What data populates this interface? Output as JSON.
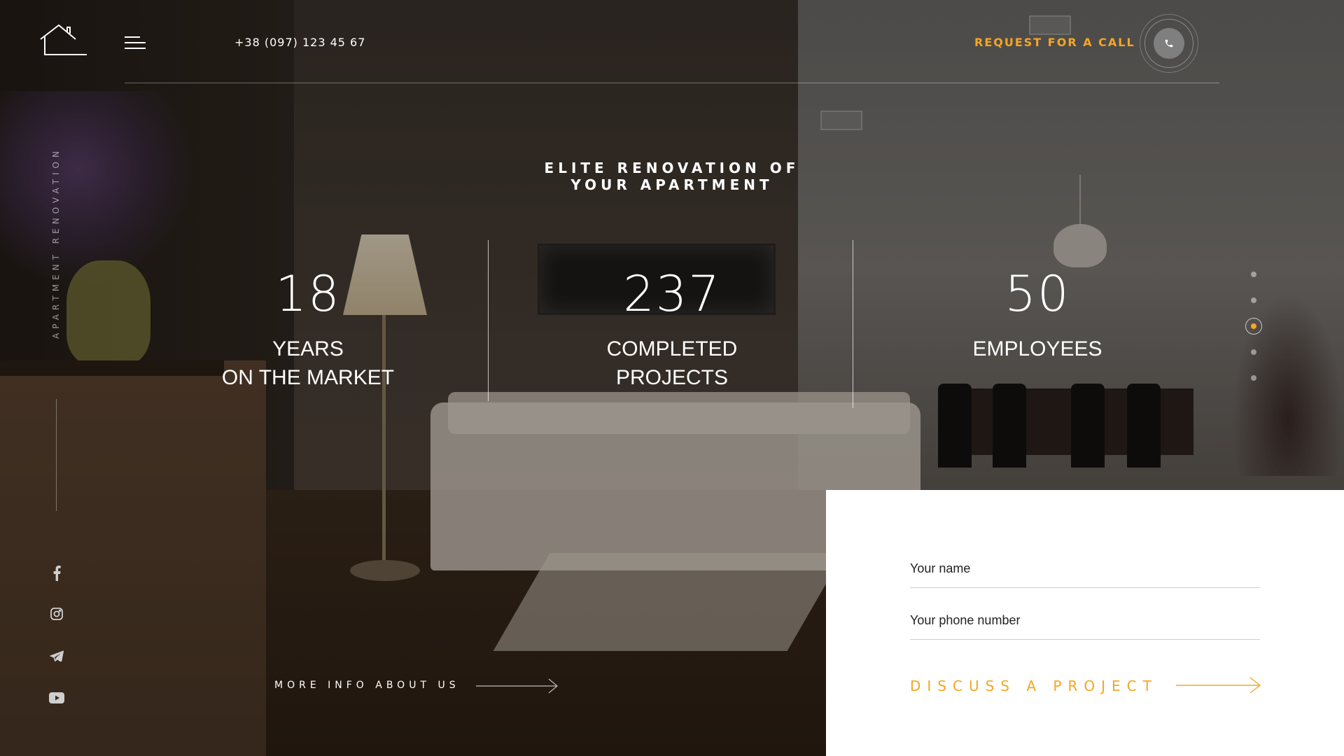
{
  "header": {
    "phone": "+38 (097) 123 45 67",
    "request_label": "REQUEST FOR A CALL"
  },
  "sidebar": {
    "vertical_label": "APARTMENT RENOVATION",
    "social": [
      {
        "name": "facebook-icon"
      },
      {
        "name": "instagram-icon"
      },
      {
        "name": "telegram-icon"
      },
      {
        "name": "youtube-icon"
      }
    ]
  },
  "hero": {
    "title": "ELITE RENOVATION OF YOUR APARTMENT",
    "stats": [
      {
        "number": "18",
        "label_line1": "YEARS",
        "label_line2": "ON THE MARKET"
      },
      {
        "number": "237",
        "label_line1": "COMPLETED",
        "label_line2": "PROJECTS"
      },
      {
        "number": "50",
        "label_line1": "EMPLOYEES",
        "label_line2": ""
      }
    ],
    "more_info": "MORE INFO ABOUT US"
  },
  "pagination": {
    "total": 5,
    "active": 3
  },
  "form": {
    "name_placeholder": "Your name",
    "phone_placeholder": "Your phone number",
    "submit_label": "DISCUSS A PROJECT"
  },
  "colors": {
    "accent": "#f5a623",
    "text": "#ffffff",
    "panel": "#ffffff"
  }
}
